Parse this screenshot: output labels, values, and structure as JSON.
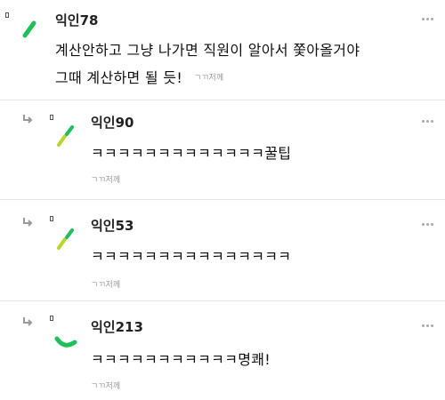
{
  "comments": [
    {
      "nickname": "익인78",
      "lines": [
        "계산안하고 그냥 나가면 직원이 알아서 쫓아올거야",
        "그때 계산하면 될 듯!"
      ],
      "meta": "ㄱㄲ저께",
      "avatar_icon": "single-green-stroke-avatar-icon"
    },
    {
      "nickname": "익인90",
      "lines": [
        "ㅋㅋㅋㅋㅋㅋㅋㅋㅋㅋㅋㅋㅋ꿀팁"
      ],
      "meta": "ㄱㄲ저께",
      "avatar_icon": "yellow-green-strokes-avatar-icon"
    },
    {
      "nickname": "익인53",
      "lines": [
        "ㅋㅋㅋㅋㅋㅋㅋㅋㅋㅋㅋㅋㅋㅋㅋ"
      ],
      "meta": "ㄱㄲ저께",
      "avatar_icon": "yellow-green-strokes-avatar-icon"
    },
    {
      "nickname": "익인213",
      "lines": [
        "ㅋㅋㅋㅋㅋㅋㅋㅋㅋㅋㅋ명쾌!"
      ],
      "meta": "ㄱㄲ저께",
      "avatar_icon": "green-arc-avatar-icon"
    }
  ],
  "colors": {
    "green": "#1fbf5a",
    "yellow_green": "#b8d62b",
    "meta_gray": "#9a9a9a",
    "divider": "#e6e6e6"
  }
}
